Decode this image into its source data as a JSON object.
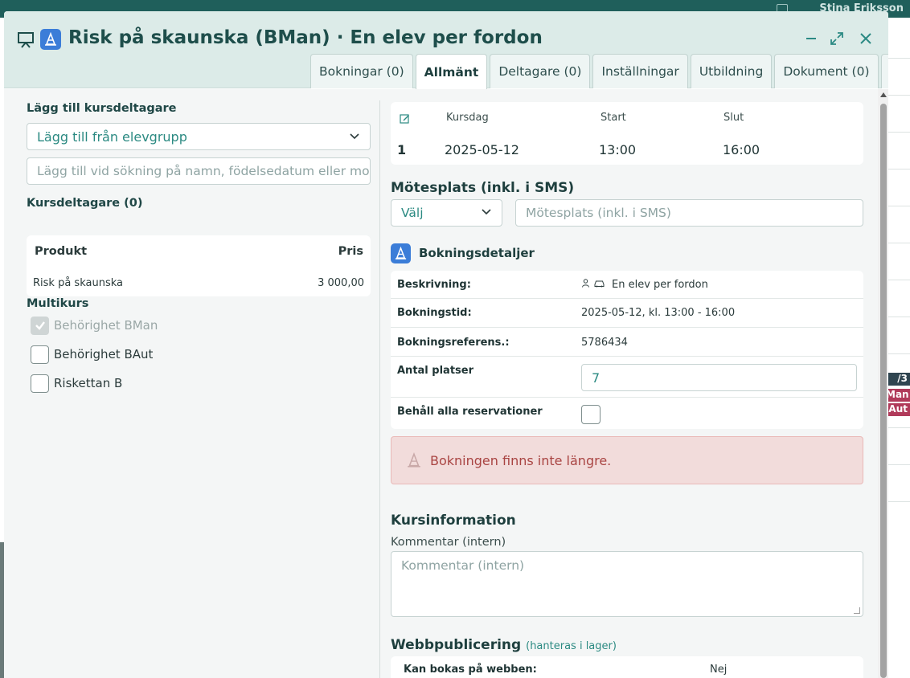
{
  "background": {
    "user_name": "Stina Eriksson",
    "tag_fraction": "/3",
    "tag_bman": "Man",
    "tag_baut": "Aut"
  },
  "modal": {
    "title": "Risk på skaunska (BMan) · En elev per fordon",
    "icons": [
      "presentation-icon",
      "traffic-cone-icon"
    ],
    "header_buttons": [
      "minimize-icon",
      "expand-icon",
      "close-icon"
    ],
    "tabs": [
      {
        "label": "Bokningar (0)",
        "active": false
      },
      {
        "label": "Allmänt",
        "active": true
      },
      {
        "label": "Deltagare (0)",
        "active": false
      },
      {
        "label": "Inställningar",
        "active": false
      },
      {
        "label": "Utbildning",
        "active": false
      },
      {
        "label": "Dokument (0)",
        "active": false
      }
    ],
    "history_icon": "history-icon"
  },
  "left": {
    "add_participants_label": "Lägg till kursdeltagare",
    "group_select_value": "Lägg till från elevgrupp",
    "search_placeholder": "Lägg till vid sökning på namn, födelsedatum eller mobil",
    "participants_label": "Kursdeltagare (0)",
    "product_table": {
      "headers": {
        "product": "Produkt",
        "price": "Pris"
      },
      "rows": [
        {
          "product": "Risk på skaunska",
          "price": "3 000,00"
        }
      ]
    },
    "multikurs_label": "Multikurs",
    "multikurs": [
      {
        "label": "Behörighet BMan",
        "checked": true,
        "disabled": true
      },
      {
        "label": "Behörighet BAut",
        "checked": false,
        "disabled": false
      },
      {
        "label": "Riskettan B",
        "checked": false,
        "disabled": false
      }
    ]
  },
  "right": {
    "schedule": {
      "headers": {
        "day": "Kursdag",
        "start": "Start",
        "end": "Slut"
      },
      "row": {
        "index": "1",
        "day": "2025-05-12",
        "start": "13:00",
        "end": "16:00"
      }
    },
    "meeting_label": "Mötesplats (inkl. i SMS)",
    "meeting_select": "Välj",
    "meeting_placeholder": "Mötesplats (inkl. i SMS)",
    "booking_details_label": "Bokningsdetaljer",
    "details": {
      "description_key": "Beskrivning:",
      "description_value": "En elev per fordon",
      "time_key": "Bokningstid:",
      "time_value": "2025-05-12, kl. 13:00 - 16:00",
      "ref_key": "Bokningsreferens.:",
      "ref_value": "5786434",
      "seats_key": "Antal platser",
      "seats_value": "7",
      "keep_key": "Behåll alla reservationer",
      "keep_checked": false
    },
    "alert_text": "Bokningen finns inte längre.",
    "course_info_label": "Kursinformation",
    "comment_label": "Kommentar (intern)",
    "comment_placeholder": "Kommentar (intern)",
    "web_label": "Webbpublicering",
    "web_hint": "(hanteras i lager)",
    "web_bookable_key": "Kan bokas på webben:",
    "web_bookable_value": "Nej"
  },
  "colors": {
    "accent": "#2b8a82",
    "header_bg": "#dcebe8",
    "alert_bg": "#f2dcdb",
    "alert_text": "#a94442",
    "icon_blue": "#3b7dd8"
  }
}
